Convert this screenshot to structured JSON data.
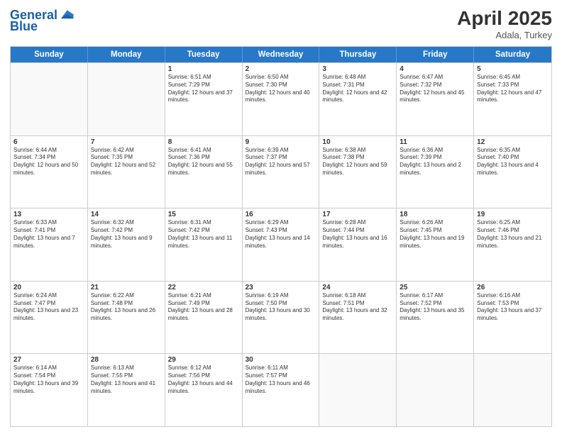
{
  "header": {
    "logo_line1": "General",
    "logo_line2": "Blue",
    "title": "April 2025",
    "location": "Adala, Turkey"
  },
  "days_of_week": [
    "Sunday",
    "Monday",
    "Tuesday",
    "Wednesday",
    "Thursday",
    "Friday",
    "Saturday"
  ],
  "weeks": [
    [
      {
        "day": "",
        "info": ""
      },
      {
        "day": "",
        "info": ""
      },
      {
        "day": "1",
        "info": "Sunrise: 6:51 AM\nSunset: 7:29 PM\nDaylight: 12 hours and 37 minutes."
      },
      {
        "day": "2",
        "info": "Sunrise: 6:50 AM\nSunset: 7:30 PM\nDaylight: 12 hours and 40 minutes."
      },
      {
        "day": "3",
        "info": "Sunrise: 6:48 AM\nSunset: 7:31 PM\nDaylight: 12 hours and 42 minutes."
      },
      {
        "day": "4",
        "info": "Sunrise: 6:47 AM\nSunset: 7:32 PM\nDaylight: 12 hours and 45 minutes."
      },
      {
        "day": "5",
        "info": "Sunrise: 6:45 AM\nSunset: 7:33 PM\nDaylight: 12 hours and 47 minutes."
      }
    ],
    [
      {
        "day": "6",
        "info": "Sunrise: 6:44 AM\nSunset: 7:34 PM\nDaylight: 12 hours and 50 minutes."
      },
      {
        "day": "7",
        "info": "Sunrise: 6:42 AM\nSunset: 7:35 PM\nDaylight: 12 hours and 52 minutes."
      },
      {
        "day": "8",
        "info": "Sunrise: 6:41 AM\nSunset: 7:36 PM\nDaylight: 12 hours and 55 minutes."
      },
      {
        "day": "9",
        "info": "Sunrise: 6:39 AM\nSunset: 7:37 PM\nDaylight: 12 hours and 57 minutes."
      },
      {
        "day": "10",
        "info": "Sunrise: 6:38 AM\nSunset: 7:38 PM\nDaylight: 12 hours and 59 minutes."
      },
      {
        "day": "11",
        "info": "Sunrise: 6:36 AM\nSunset: 7:39 PM\nDaylight: 13 hours and 2 minutes."
      },
      {
        "day": "12",
        "info": "Sunrise: 6:35 AM\nSunset: 7:40 PM\nDaylight: 13 hours and 4 minutes."
      }
    ],
    [
      {
        "day": "13",
        "info": "Sunrise: 6:33 AM\nSunset: 7:41 PM\nDaylight: 13 hours and 7 minutes."
      },
      {
        "day": "14",
        "info": "Sunrise: 6:32 AM\nSunset: 7:42 PM\nDaylight: 13 hours and 9 minutes."
      },
      {
        "day": "15",
        "info": "Sunrise: 6:31 AM\nSunset: 7:42 PM\nDaylight: 13 hours and 11 minutes."
      },
      {
        "day": "16",
        "info": "Sunrise: 6:29 AM\nSunset: 7:43 PM\nDaylight: 13 hours and 14 minutes."
      },
      {
        "day": "17",
        "info": "Sunrise: 6:28 AM\nSunset: 7:44 PM\nDaylight: 13 hours and 16 minutes."
      },
      {
        "day": "18",
        "info": "Sunrise: 6:26 AM\nSunset: 7:45 PM\nDaylight: 13 hours and 19 minutes."
      },
      {
        "day": "19",
        "info": "Sunrise: 6:25 AM\nSunset: 7:46 PM\nDaylight: 13 hours and 21 minutes."
      }
    ],
    [
      {
        "day": "20",
        "info": "Sunrise: 6:24 AM\nSunset: 7:47 PM\nDaylight: 13 hours and 23 minutes."
      },
      {
        "day": "21",
        "info": "Sunrise: 6:22 AM\nSunset: 7:48 PM\nDaylight: 13 hours and 26 minutes."
      },
      {
        "day": "22",
        "info": "Sunrise: 6:21 AM\nSunset: 7:49 PM\nDaylight: 13 hours and 28 minutes."
      },
      {
        "day": "23",
        "info": "Sunrise: 6:19 AM\nSunset: 7:50 PM\nDaylight: 13 hours and 30 minutes."
      },
      {
        "day": "24",
        "info": "Sunrise: 6:18 AM\nSunset: 7:51 PM\nDaylight: 13 hours and 32 minutes."
      },
      {
        "day": "25",
        "info": "Sunrise: 6:17 AM\nSunset: 7:52 PM\nDaylight: 13 hours and 35 minutes."
      },
      {
        "day": "26",
        "info": "Sunrise: 6:16 AM\nSunset: 7:53 PM\nDaylight: 13 hours and 37 minutes."
      }
    ],
    [
      {
        "day": "27",
        "info": "Sunrise: 6:14 AM\nSunset: 7:54 PM\nDaylight: 13 hours and 39 minutes."
      },
      {
        "day": "28",
        "info": "Sunrise: 6:13 AM\nSunset: 7:55 PM\nDaylight: 13 hours and 41 minutes."
      },
      {
        "day": "29",
        "info": "Sunrise: 6:12 AM\nSunset: 7:56 PM\nDaylight: 13 hours and 44 minutes."
      },
      {
        "day": "30",
        "info": "Sunrise: 6:11 AM\nSunset: 7:57 PM\nDaylight: 13 hours and 46 minutes."
      },
      {
        "day": "",
        "info": ""
      },
      {
        "day": "",
        "info": ""
      },
      {
        "day": "",
        "info": ""
      }
    ]
  ]
}
